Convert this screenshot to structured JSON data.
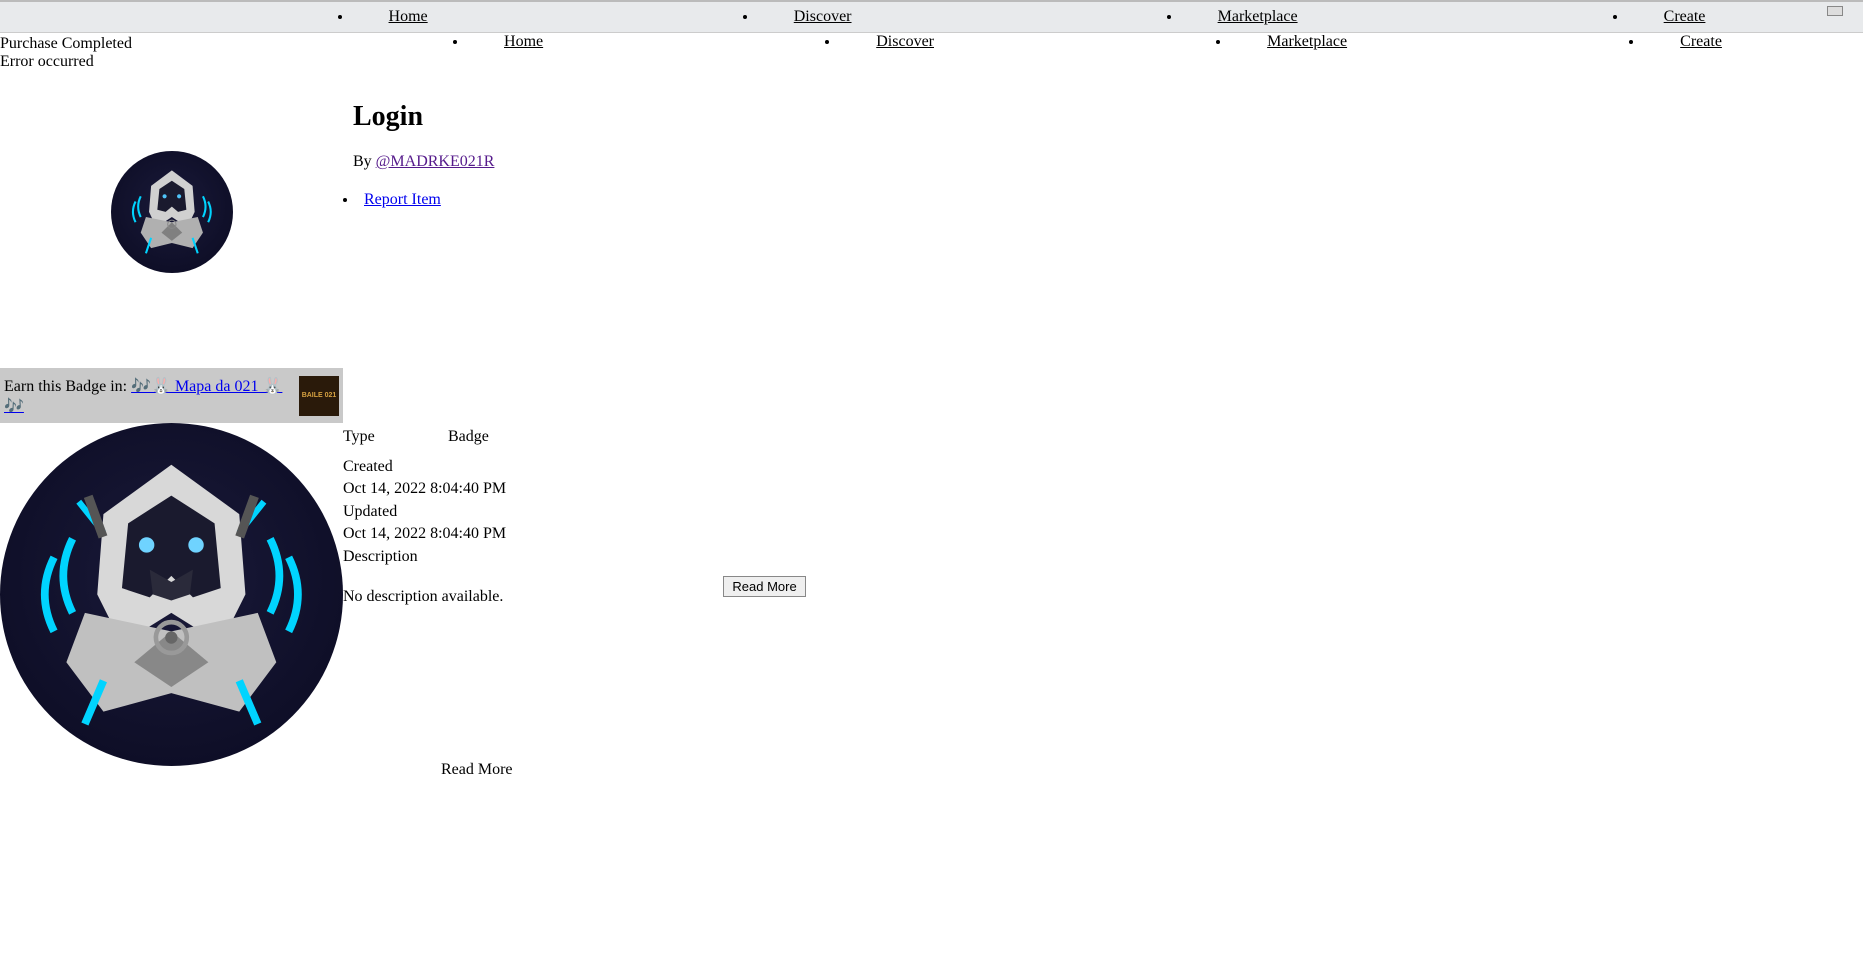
{
  "nav": {
    "items": [
      "Home",
      "Discover",
      "Marketplace",
      "Create"
    ]
  },
  "status": {
    "purchase": "Purchase Completed",
    "error": "Error occurred"
  },
  "page": {
    "title": "Login",
    "by_prefix": "By ",
    "author": "@MADRKE021R",
    "report": "Report Item"
  },
  "badge": {
    "prefix": "Earn this Badge in: ",
    "link": "🎶🐰 Mapa da 021 🐰🎶",
    "thumb_text": "BAILE 021"
  },
  "details": {
    "type_label": "Type",
    "type_value": "Badge",
    "created_label": "Created",
    "created_value": "Oct 14, 2022 8:04:40 PM",
    "updated_label": "Updated",
    "updated_value": "Oct 14, 2022 8:04:40 PM",
    "description_label": "Description",
    "description_value": "No description available.",
    "read_more_button": "Read More",
    "read_more_text": "Read More"
  }
}
